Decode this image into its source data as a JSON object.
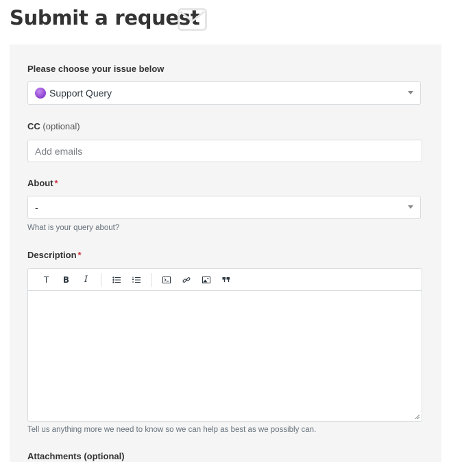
{
  "page": {
    "title": "Submit a request",
    "title_icon": "envelope-icon"
  },
  "form": {
    "issue": {
      "label": "Please choose your issue below",
      "selected": "Support Query",
      "dot_color": "#8a3fcf"
    },
    "cc": {
      "label": "CC",
      "optional": "(optional)",
      "placeholder": "Add emails"
    },
    "about": {
      "label": "About",
      "required_mark": "*",
      "selected": "-",
      "hint": "What is your query about?"
    },
    "description": {
      "label": "Description",
      "required_mark": "*",
      "hint": "Tell us anything more we need to know so we can help as best as we possibly can.",
      "toolbar": {
        "text_style_glyph": "T",
        "bold_glyph": "B",
        "italic_glyph": "I",
        "buttons": [
          "text-style-icon",
          "bold-icon",
          "italic-icon",
          "bulleted-list-icon",
          "numbered-list-icon",
          "code-block-icon",
          "link-icon",
          "image-icon",
          "quote-icon"
        ]
      }
    },
    "next_field_label": "Attachments (optional)"
  },
  "colors": {
    "required": "#cc3340",
    "panel_bg": "#f5f5f5",
    "border": "#d8dcde"
  }
}
